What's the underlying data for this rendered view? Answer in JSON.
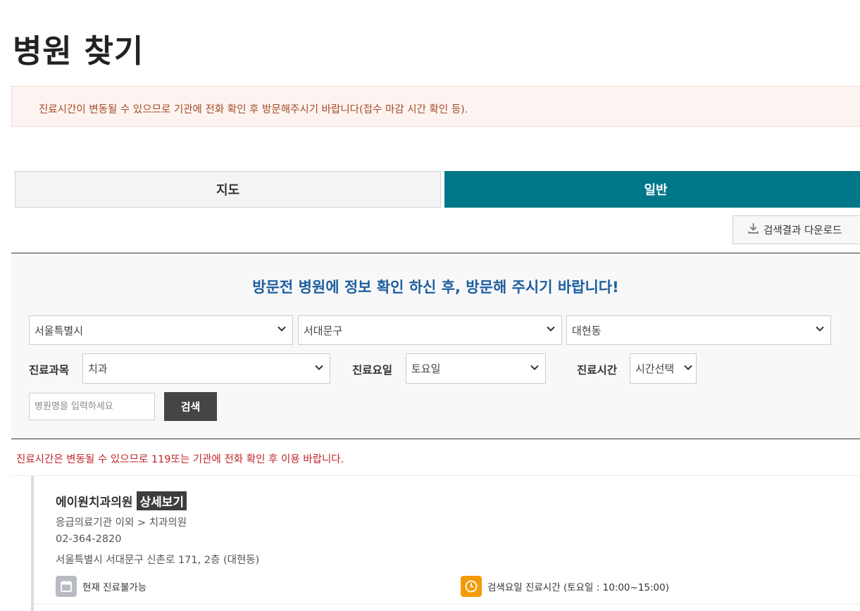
{
  "page": {
    "title": "병원 찾기"
  },
  "notice": {
    "text": "진료시간이 변동될 수 있으므로 기관에 전화 확인 후 방문해주시기 바랍니다(접수 마감 시간 확인 등)."
  },
  "tabs": [
    {
      "label": "지도",
      "active": false
    },
    {
      "label": "일반",
      "active": true
    }
  ],
  "download": {
    "label": "검색결과 다운로드",
    "icon": "download-icon"
  },
  "search": {
    "heading": "방문전 병원에 정보 확인 하신 후, 방문해 주시기 바랍니다!",
    "region": {
      "city": "서울특별시",
      "district": "서대문구",
      "dong": "대현동"
    },
    "department": {
      "label": "진료과목",
      "value": "치과"
    },
    "day": {
      "label": "진료요일",
      "value": "토요일"
    },
    "time": {
      "label": "진료시간",
      "value": "시간선택"
    },
    "name_placeholder": "병원명을 입력하세요",
    "search_button": "검색"
  },
  "warning": {
    "text": "진료시간은 변동될 수 있으므로 119또는 기관에 전화 확인 후 이용 바랍니다."
  },
  "results": [
    {
      "name": "에이원치과의원",
      "detail_button": "상세보기",
      "category": "응급의료기관 이외 > 치과의원",
      "phone": "02-364-2820",
      "address": "서울특별시 서대문구 신촌로 171, 2층 (대현동)",
      "current_status": "현재 진료불가능",
      "search_hours": "검색요일 진료시간 (토요일 : 10:00~15:00)"
    }
  ],
  "colors": {
    "accent": "#007689",
    "heading_blue": "#1e5fa0",
    "warning_red": "#c0242b",
    "notice_brown": "#a24a24",
    "clock_orange": "#f29a09"
  }
}
